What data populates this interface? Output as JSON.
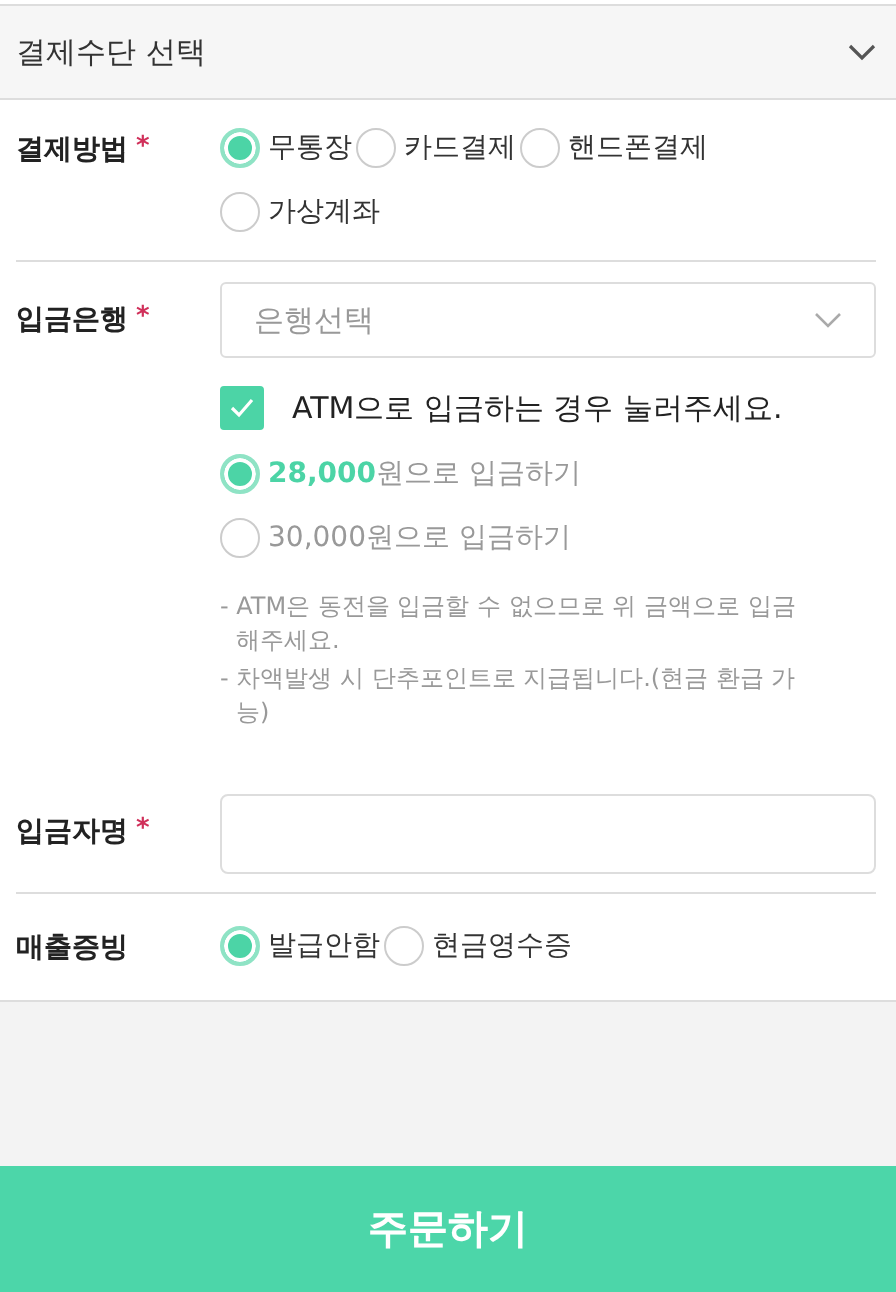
{
  "header": {
    "title": "결제수단 선택",
    "expanded": true
  },
  "payment_method": {
    "label": "결제방법",
    "required_mark": "*",
    "options": [
      {
        "label": "무통장",
        "selected": true
      },
      {
        "label": "카드결제",
        "selected": false
      },
      {
        "label": "핸드폰결제",
        "selected": false
      },
      {
        "label": "가상계좌",
        "selected": false
      }
    ]
  },
  "bank": {
    "label": "입금은행",
    "required_mark": "*",
    "select": {
      "placeholder": "은행선택"
    },
    "atm": {
      "label": "ATM으로 입금하는 경우 눌러주세요.",
      "checked": true
    },
    "amounts": [
      {
        "label": "**28,000**원으로 입금하기",
        "selected": true
      },
      {
        "label": "30,000원으로 입금하기",
        "selected": false
      }
    ],
    "notes": [
      "- ATM은 동전을 입금할 수 없으므로 위 금액으로 입금해주세요.",
      "- 차액발생 시 단추포인트로 지급됩니다.(현금 환급 가능)"
    ]
  },
  "depositor": {
    "label": "입금자명",
    "required_mark": "*"
  },
  "receipt": {
    "label": "매출증빙",
    "options": [
      {
        "label": "발급안함",
        "selected": true
      },
      {
        "label": "현금영수증",
        "selected": false
      }
    ]
  },
  "order_button": {
    "label": "주문하기"
  }
}
